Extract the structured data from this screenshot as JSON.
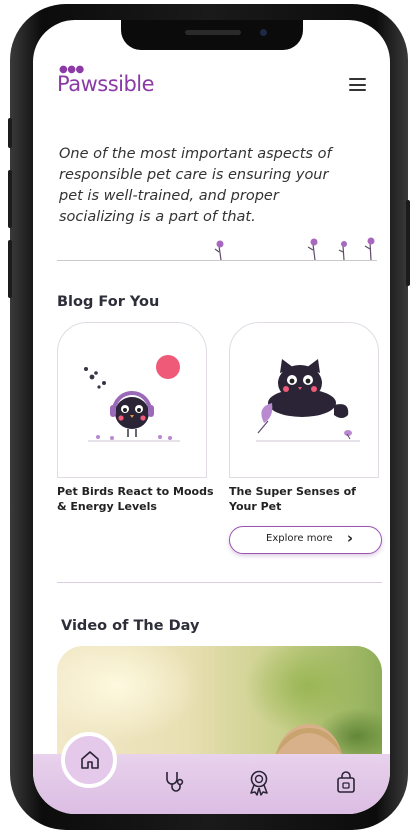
{
  "app": {
    "logo_text": "Pawssible"
  },
  "colors": {
    "brand": "#8b3aa6",
    "nav_bg": "#dcbde3",
    "accent_dot": "#ef5a78"
  },
  "hero": {
    "quote": "One of the most important aspects of responsible pet care is ensuring your pet is well-trained, and proper socializing is a part of that."
  },
  "blog": {
    "section_title": "Blog For You",
    "cards": [
      {
        "title": "Pet Birds React to Moods & Energy Levels",
        "image_icon": "bird-with-headphones"
      },
      {
        "title": "The Super Senses of Your Pet",
        "image_icon": "black-cat"
      }
    ],
    "explore_label": "Explore more"
  },
  "video": {
    "section_title": "Video of The Day"
  },
  "nav": {
    "items": [
      "home-icon",
      "stethoscope-icon",
      "award-icon",
      "shopping-bag-icon"
    ],
    "active": "home-icon"
  }
}
